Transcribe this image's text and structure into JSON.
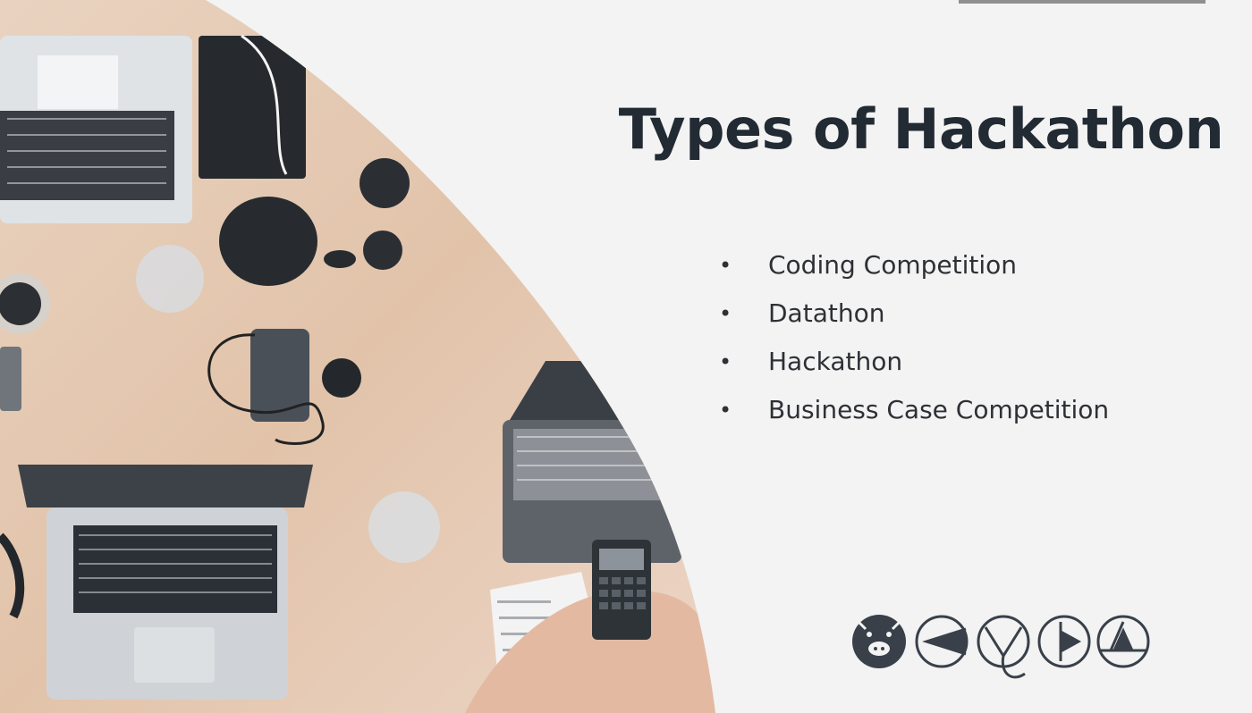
{
  "slide": {
    "title": "Types of Hackathon",
    "bullets": [
      {
        "marker": "•",
        "label": "Coding Competition"
      },
      {
        "marker": "•",
        "label": "Datathon"
      },
      {
        "marker": "•",
        "label": "Hackathon"
      },
      {
        "marker": "•",
        "label": "Business Case Competition"
      }
    ]
  },
  "colors": {
    "background": "#f2f3f2",
    "title": "#222a33",
    "text": "#2e3036",
    "accent_bar": "#8f8f8f",
    "logo": "#39404a"
  },
  "icons": [
    "pig-face-icon",
    "left-arrow-circle-icon",
    "y-letter-icon",
    "play-circle-icon",
    "triangle-circle-icon"
  ]
}
